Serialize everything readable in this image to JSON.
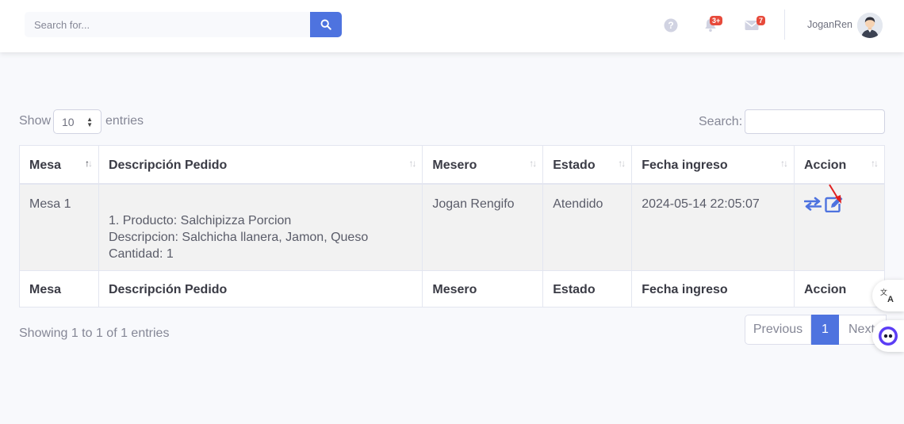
{
  "topbar": {
    "search_placeholder": "Search for...",
    "alerts_badge": "3+",
    "messages_badge": "7",
    "user_name": "JoganRen"
  },
  "controls": {
    "show_label": "Show",
    "entries_value": "10",
    "entries_label": "entries",
    "search_label": "Search:"
  },
  "table": {
    "headers": [
      "Mesa",
      "Descripción Pedido",
      "Mesero",
      "Estado",
      "Fecha ingreso",
      "Accion"
    ],
    "rows": [
      {
        "mesa": "Mesa 1",
        "descripcion": {
          "line1": "1. Producto: Salchipizza Porcion",
          "line2": "Descripcion: Salchicha llanera, Jamon, Queso",
          "line3": "Cantidad: 1"
        },
        "mesero": "Jogan Rengifo",
        "estado": "Atendido",
        "fecha": "2024-05-14 22:05:07"
      }
    ]
  },
  "footer": {
    "info": "Showing 1 to 1 of 1 entries",
    "previous": "Previous",
    "current_page": "1",
    "next": "Next"
  },
  "colors": {
    "primary": "#4e73df",
    "danger": "#e74a3b"
  }
}
